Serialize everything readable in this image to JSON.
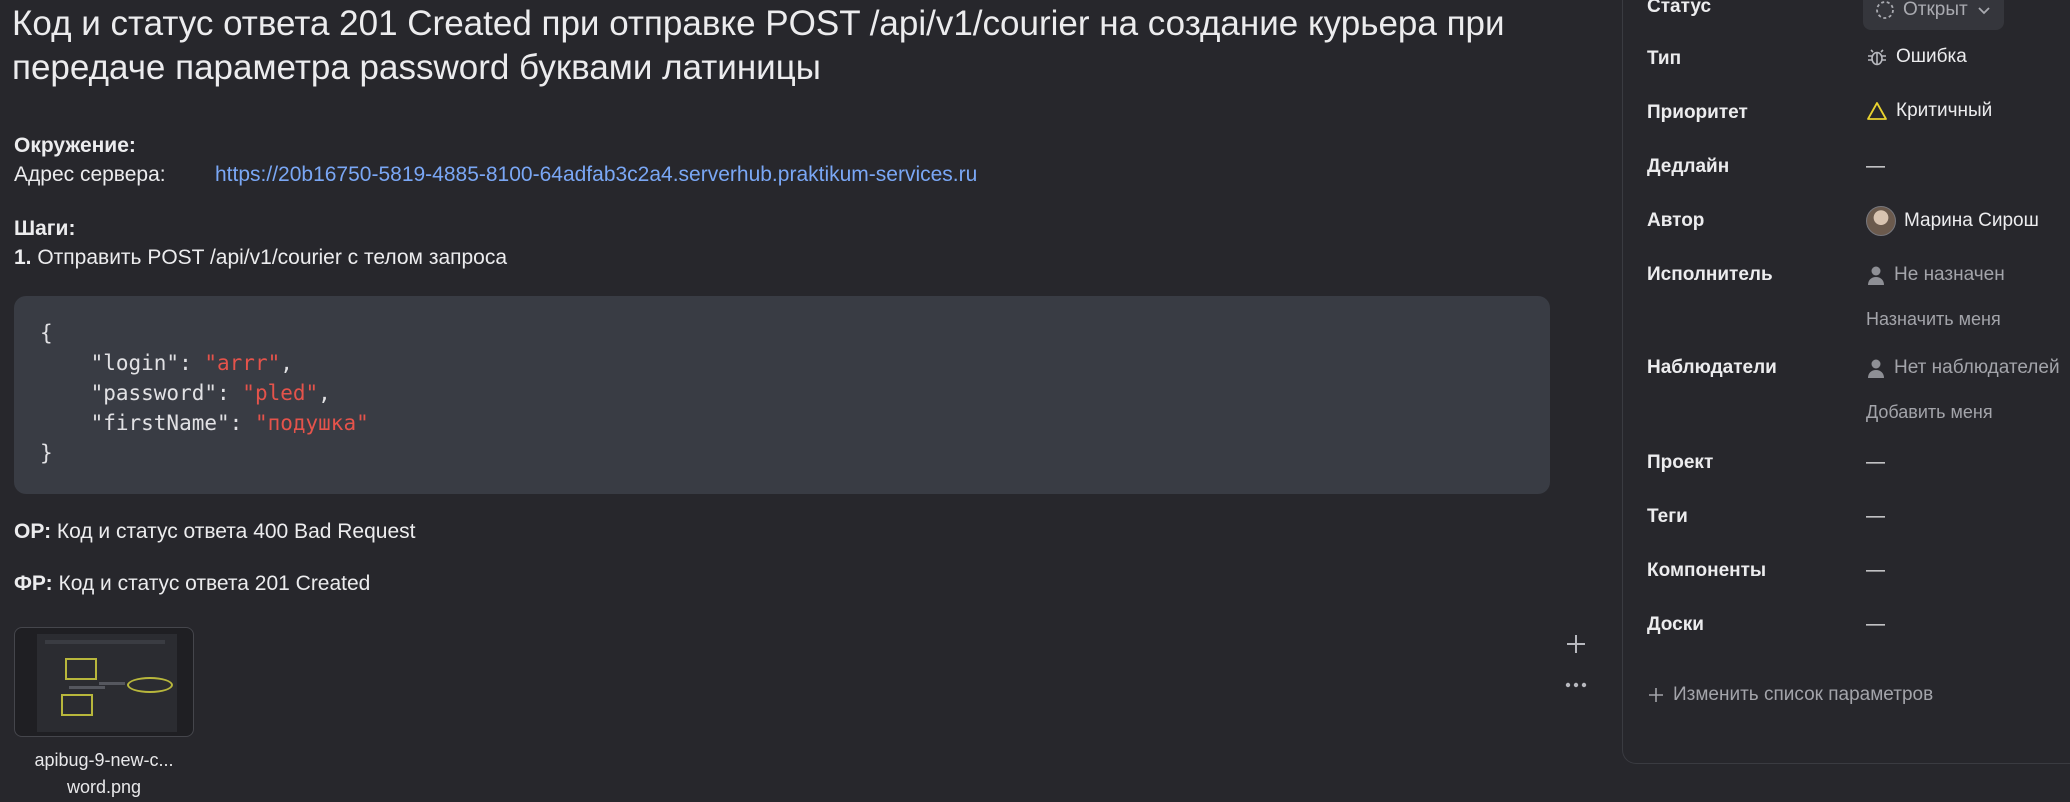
{
  "issue": {
    "title": "Код и статус ответа 201 Created при отправке POST /api/v1/courier на создание курьера при передаче параметра password буквами латиницы"
  },
  "environment": {
    "label": "Окружение:",
    "server_label": "Адрес сервера:",
    "server_url": "https://20b16750-5819-4885-8100-64adfab3c2a4.serverhub.praktikum-services.ru"
  },
  "steps": {
    "label": "Шаги:",
    "step_number": "1.",
    "step_text": " Отправить POST /api/v1/courier с телом запроса"
  },
  "code": {
    "open_brace": "{",
    "close_brace": "}",
    "lines": [
      {
        "key": "    \"login\": ",
        "value": "\"arrr\"",
        "tail": ","
      },
      {
        "key": "    \"password\": ",
        "value": "\"pled\"",
        "tail": ","
      },
      {
        "key": "    \"firstName\": ",
        "value": "\"подушка\"",
        "tail": ""
      }
    ]
  },
  "expected": {
    "label": "ОР:",
    "text": " Код и статус ответа 400 Bad Request"
  },
  "actual": {
    "label": "ФР:",
    "text": " Код и статус ответа 201 Created"
  },
  "attachment": {
    "name": "apibug-9-new-c...\nword.png"
  },
  "actions": {
    "add_icon": "plus-icon",
    "more_icon": "more-dots-icon"
  },
  "side_panel": {
    "status": {
      "label": "Статус",
      "value": "Открыт"
    },
    "type": {
      "label": "Тип",
      "value": "Ошибка"
    },
    "priority": {
      "label": "Приоритет",
      "value": "Критичный"
    },
    "deadline": {
      "label": "Дедлайн",
      "value": "—"
    },
    "author": {
      "label": "Автор",
      "value": "Марина Сирош"
    },
    "assignee": {
      "label": "Исполнитель",
      "value": "Не назначен",
      "action": "Назначить меня"
    },
    "followers": {
      "label": "Наблюдатели",
      "value": "Нет наблюдателей",
      "action": "Добавить меня"
    },
    "project": {
      "label": "Проект",
      "value": "—"
    },
    "tags": {
      "label": "Теги",
      "value": "—"
    },
    "components": {
      "label": "Компоненты",
      "value": "—"
    },
    "boards": {
      "label": "Доски",
      "value": "—"
    },
    "edit_params": "Изменить список параметров"
  },
  "colors": {
    "background": "#27272c",
    "link": "#7aa7f5",
    "code_bg": "#393c44",
    "code_string": "#e5534b",
    "priority_warning": "#e8d22f"
  }
}
